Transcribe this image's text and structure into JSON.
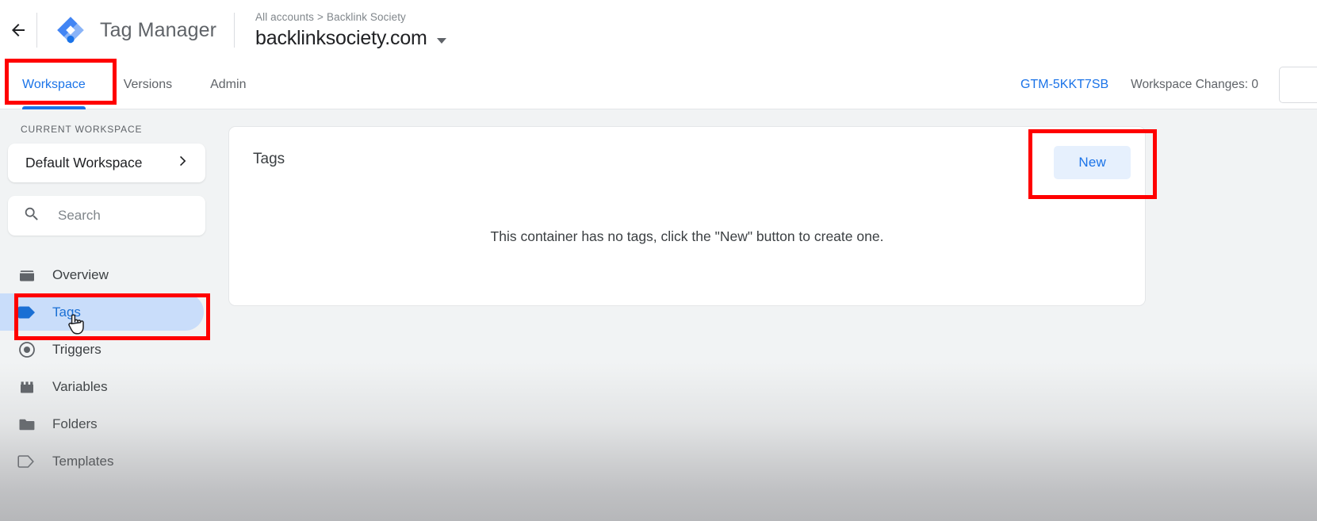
{
  "header": {
    "back_icon": "arrow-left-icon",
    "logo_icon": "tag-manager-logo-icon",
    "product_name": "Tag Manager",
    "breadcrumb_root": "All accounts",
    "breadcrumb_separator": ">",
    "breadcrumb_account": "Backlink Society",
    "container_name": "backlinksociety.com",
    "container_dropdown_icon": "chevron-down-icon"
  },
  "tabs": [
    {
      "label": "Workspace",
      "active": true
    },
    {
      "label": "Versions",
      "active": false
    },
    {
      "label": "Admin",
      "active": false
    }
  ],
  "topright": {
    "container_id": "GTM-5KKT7SB",
    "workspace_changes": "Workspace Changes: 0",
    "preview_button": ""
  },
  "sidebar": {
    "section_label": "CURRENT WORKSPACE",
    "workspace_name": "Default Workspace",
    "workspace_chevron_icon": "chevron-right-icon",
    "search_icon": "search-icon",
    "search_placeholder": "Search",
    "search_value": "",
    "items": [
      {
        "label": "Overview",
        "icon": "overview-icon",
        "selected": false
      },
      {
        "label": "Tags",
        "icon": "tag-icon",
        "selected": true
      },
      {
        "label": "Triggers",
        "icon": "trigger-icon",
        "selected": false
      },
      {
        "label": "Variables",
        "icon": "variable-icon",
        "selected": false
      },
      {
        "label": "Folders",
        "icon": "folder-icon",
        "selected": false
      },
      {
        "label": "Templates",
        "icon": "template-icon",
        "selected": false
      }
    ]
  },
  "main": {
    "card_title": "Tags",
    "new_button": "New",
    "empty_message": "This container has no tags, click the \"New\" button to create one."
  },
  "annotations": {
    "highlight_color": "#ff0000",
    "boxes": [
      "workspace-tab",
      "tags-nav-item",
      "new-button"
    ]
  },
  "colors": {
    "accent_blue": "#1a73e8",
    "selected_nav_bg": "#c9ddfa",
    "new_button_bg": "#e6f0fd",
    "page_bg": "#f1f3f4",
    "text_primary": "#202124",
    "text_secondary": "#5f6368"
  }
}
